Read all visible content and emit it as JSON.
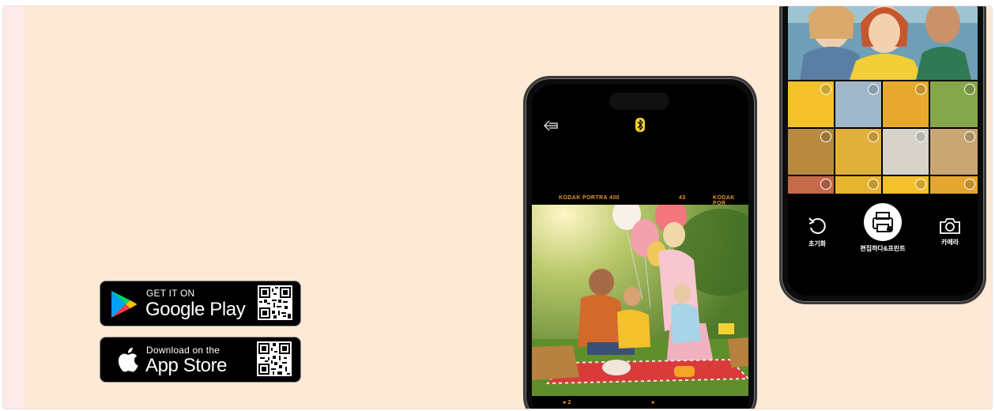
{
  "badges": {
    "google": {
      "line1": "GET IT ON",
      "line2": "Google Play"
    },
    "apple": {
      "line1": "Download on the",
      "line2": "App Store"
    }
  },
  "left_phone": {
    "film_top_left": "KODAK  PORTRA 400",
    "film_top_mid": "43",
    "film_top_right": "KODAK  POR",
    "film_bottom_left": "▸ 2",
    "film_bottom_right": "▸"
  },
  "right_phone": {
    "reset_label": "초기화",
    "edit_print_label": "편집하다&프린트",
    "camera_label": "카메라"
  },
  "colors": {
    "panel": "#fde9d5",
    "film_text": "#e3962f",
    "bluetooth": "#f3d42c"
  }
}
